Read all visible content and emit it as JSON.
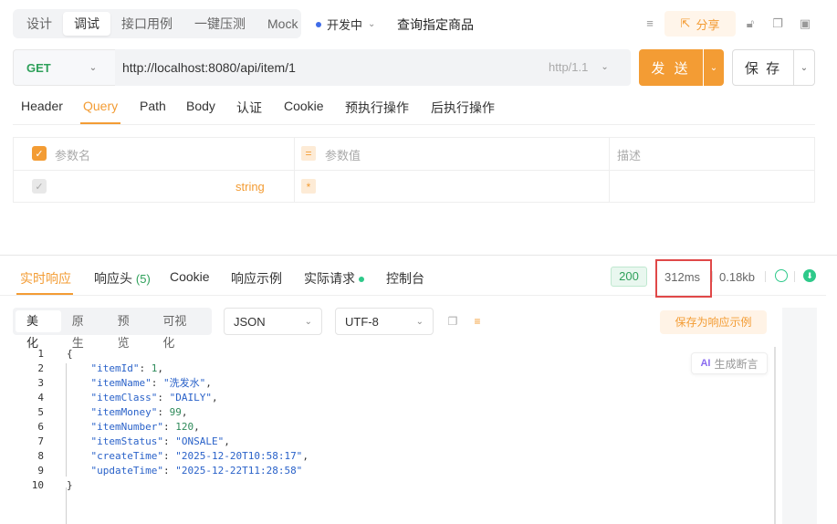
{
  "mode_tabs": [
    "设计",
    "调试",
    "接口用例",
    "一键压测",
    "Mock"
  ],
  "active_mode": "调试",
  "env_status": "开发中",
  "api_name": "查询指定商品",
  "share_label": "分享",
  "request": {
    "method": "GET",
    "url": "http://localhost:8080/api/item/1",
    "protocol": "http/1.1",
    "send_label": "发 送",
    "save_label": "保 存"
  },
  "request_tabs": [
    "Header",
    "Query",
    "Path",
    "Body",
    "认证",
    "Cookie",
    "预执行操作",
    "后执行操作"
  ],
  "active_request_tab": "Query",
  "params_table": {
    "headers": {
      "name": "参数名",
      "value": "参数值",
      "desc": "描述"
    },
    "rows": [
      {
        "name": "",
        "type": "string",
        "required": "*",
        "value": "",
        "desc": ""
      }
    ]
  },
  "response_tabs": {
    "realtime": "实时响应",
    "headers": "响应头",
    "headers_count": "(5)",
    "cookie": "Cookie",
    "example": "响应示例",
    "actual_request": "实际请求",
    "console": "控制台"
  },
  "response_meta": {
    "status": "200",
    "time": "312ms",
    "size": "0.18kb"
  },
  "view_tabs": [
    "美化",
    "原生",
    "预览",
    "可视化"
  ],
  "format_select": "JSON",
  "encoding_select": "UTF-8",
  "save_example_label": "保存为响应示例",
  "ai_assert_label": "生成断言",
  "code_lines": [
    {
      "no": "1",
      "text": "{"
    },
    {
      "no": "2",
      "key": "\"itemId\"",
      "val": "1",
      "vtype": "n",
      "comma": ","
    },
    {
      "no": "3",
      "key": "\"itemName\"",
      "val": "\"洗发水\"",
      "vtype": "s",
      "comma": ","
    },
    {
      "no": "4",
      "key": "\"itemClass\"",
      "val": "\"DAILY\"",
      "vtype": "s",
      "comma": ","
    },
    {
      "no": "5",
      "key": "\"itemMoney\"",
      "val": "99",
      "vtype": "n",
      "comma": ","
    },
    {
      "no": "6",
      "key": "\"itemNumber\"",
      "val": "120",
      "vtype": "n",
      "comma": ","
    },
    {
      "no": "7",
      "key": "\"itemStatus\"",
      "val": "\"ONSALE\"",
      "vtype": "s",
      "comma": ","
    },
    {
      "no": "8",
      "key": "\"createTime\"",
      "val": "\"2025-12-20T10:58:17\"",
      "vtype": "s",
      "comma": ","
    },
    {
      "no": "9",
      "key": "\"updateTime\"",
      "val": "\"2025-12-22T11:28:58\"",
      "vtype": "s",
      "comma": ""
    },
    {
      "no": "10",
      "text": "}"
    }
  ],
  "colors": {
    "accent": "#f39c34",
    "method_get": "#2ea05a",
    "highlight_box": "#e04848"
  }
}
